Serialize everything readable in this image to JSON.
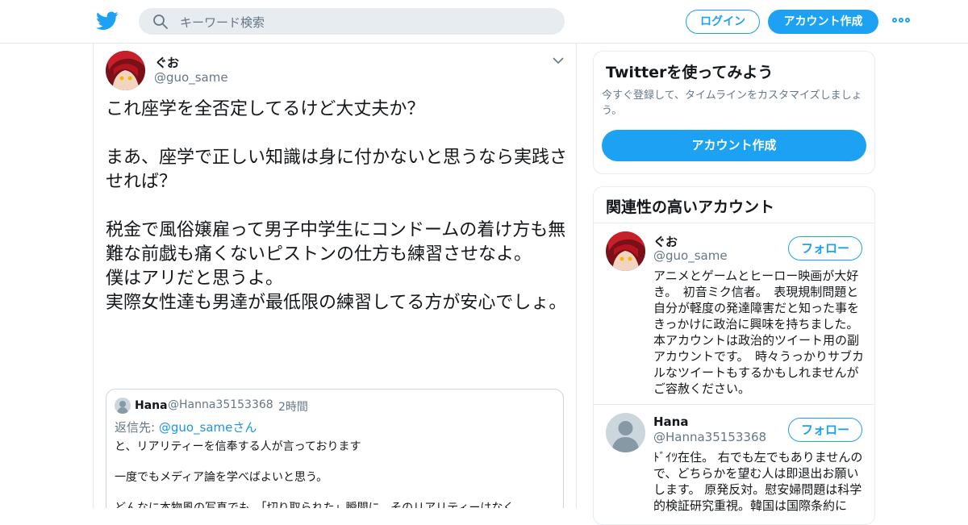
{
  "header": {
    "search_placeholder": "キーワード検索",
    "login_label": "ログイン",
    "signup_label": "アカウント作成",
    "colors": {
      "accent": "#1da1f2",
      "search_bg": "#e6ecf0"
    }
  },
  "tweet": {
    "name": "ぐお",
    "handle": "@guo_same",
    "text": "これ座学を全否定してるけど大丈夫か？\n\nまあ、座学で正しい知識は身に付かないと思うなら実践させれば？\n\n税金で風俗嬢雇って男子中学生にコンドームの着け方も無難な前戯も痛くないピストンの仕方も練習させなよ。\n僕はアリだと思うよ。\n実際女性達も男達が最低限の練習してる方が安心でしょ。",
    "quote": {
      "name": "Hana",
      "handle": "@Hanna35153368",
      "dot": "·",
      "time": "2時間",
      "reply_prefix": "返信先:",
      "reply_handle": "@guo_same",
      "reply_suffix": "さん",
      "lines": [
        "と、リアリティーを信奉する人が言っております",
        "一度でもメディア論を学べばよいと思う。",
        "どんなに本物風の写真でも、「切り取られた」瞬間に、そのリアリティーはなく"
      ]
    }
  },
  "sidebar": {
    "try_twitter": {
      "title": "Twitterを使ってみよう",
      "subtitle": "今すぐ登録して、タイムラインをカスタマイズしましょう。",
      "button": "アカウント作成"
    },
    "related": {
      "title": "関連性の高いアカウント",
      "accounts": [
        {
          "name": "ぐお",
          "handle": "@guo_same",
          "follow_label": "フォロー",
          "bio": "アニメとゲームとヒーロー映画が大好き。　初音ミク信者。　表現規制問題と自分が軽度の発達障害だと知った事をきっかけに政治に興味を持ちました。　本アカウントは政治的ツイート用の副アカウントです。　時々うっかりサブカルなツイートもするかもしれませんがご容赦ください。"
        },
        {
          "name": "Hana",
          "handle": "@Hanna35153368",
          "follow_label": "フォロー",
          "bio": "ﾄﾞｲﾂ在住。 右でも左でもありませんので、どちらかを望む人は即退出お願いします。 原発反対。慰安婦問題は科学的検証研究重視。韓国は国際条約に"
        }
      ]
    }
  }
}
